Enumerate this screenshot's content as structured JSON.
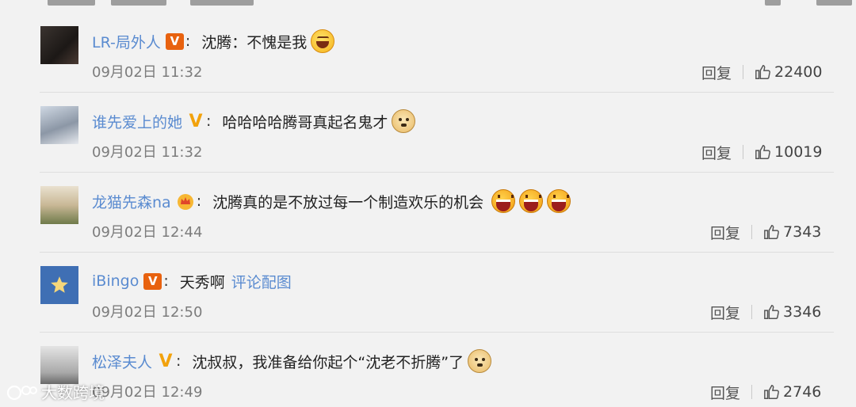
{
  "comments": [
    {
      "username": "LR-局外人",
      "badge": "V",
      "badge_type": "orange-box",
      "text": "沈腾：不愧是我",
      "emojis": [
        "laugh-tears"
      ],
      "timestamp": "09月02日 11:32",
      "reply_label": "回复",
      "likes": "22400"
    },
    {
      "username": "谁先爱上的她",
      "badge": "V",
      "badge_type": "yellow-plain",
      "text": "哈哈哈哈腾哥真起名鬼才",
      "emojis": [
        "doge"
      ],
      "timestamp": "09月02日 11:32",
      "reply_label": "回复",
      "likes": "10019"
    },
    {
      "username": "龙猫先森na",
      "badge": "crown",
      "badge_type": "crown",
      "text": "沈腾真的是不放过每一个制造欢乐的机会",
      "emojis": [
        "grin",
        "grin",
        "grin"
      ],
      "timestamp": "09月02日 12:44",
      "reply_label": "回复",
      "likes": "7343"
    },
    {
      "username": "iBingo",
      "badge": "V",
      "badge_type": "orange-box",
      "text": "天秀啊",
      "link": "评论配图",
      "emojis": [],
      "timestamp": "09月02日 12:50",
      "reply_label": "回复",
      "likes": "3346"
    },
    {
      "username": "松泽夫人",
      "badge": "V",
      "badge_type": "yellow-plain",
      "text": "沈叔叔，我准备给你起个“沈老不折腾”了",
      "emojis": [
        "doge"
      ],
      "timestamp": "09月02日 12:49",
      "reply_label": "回复",
      "likes": "2746"
    }
  ],
  "watermark": {
    "text": "大数跨境",
    "icon": "logo-icon"
  },
  "colors": {
    "username": "#5a8bd0",
    "badge_orange": "#e8620f",
    "badge_yellow": "#f2a20c",
    "background": "#f2f2f2"
  }
}
